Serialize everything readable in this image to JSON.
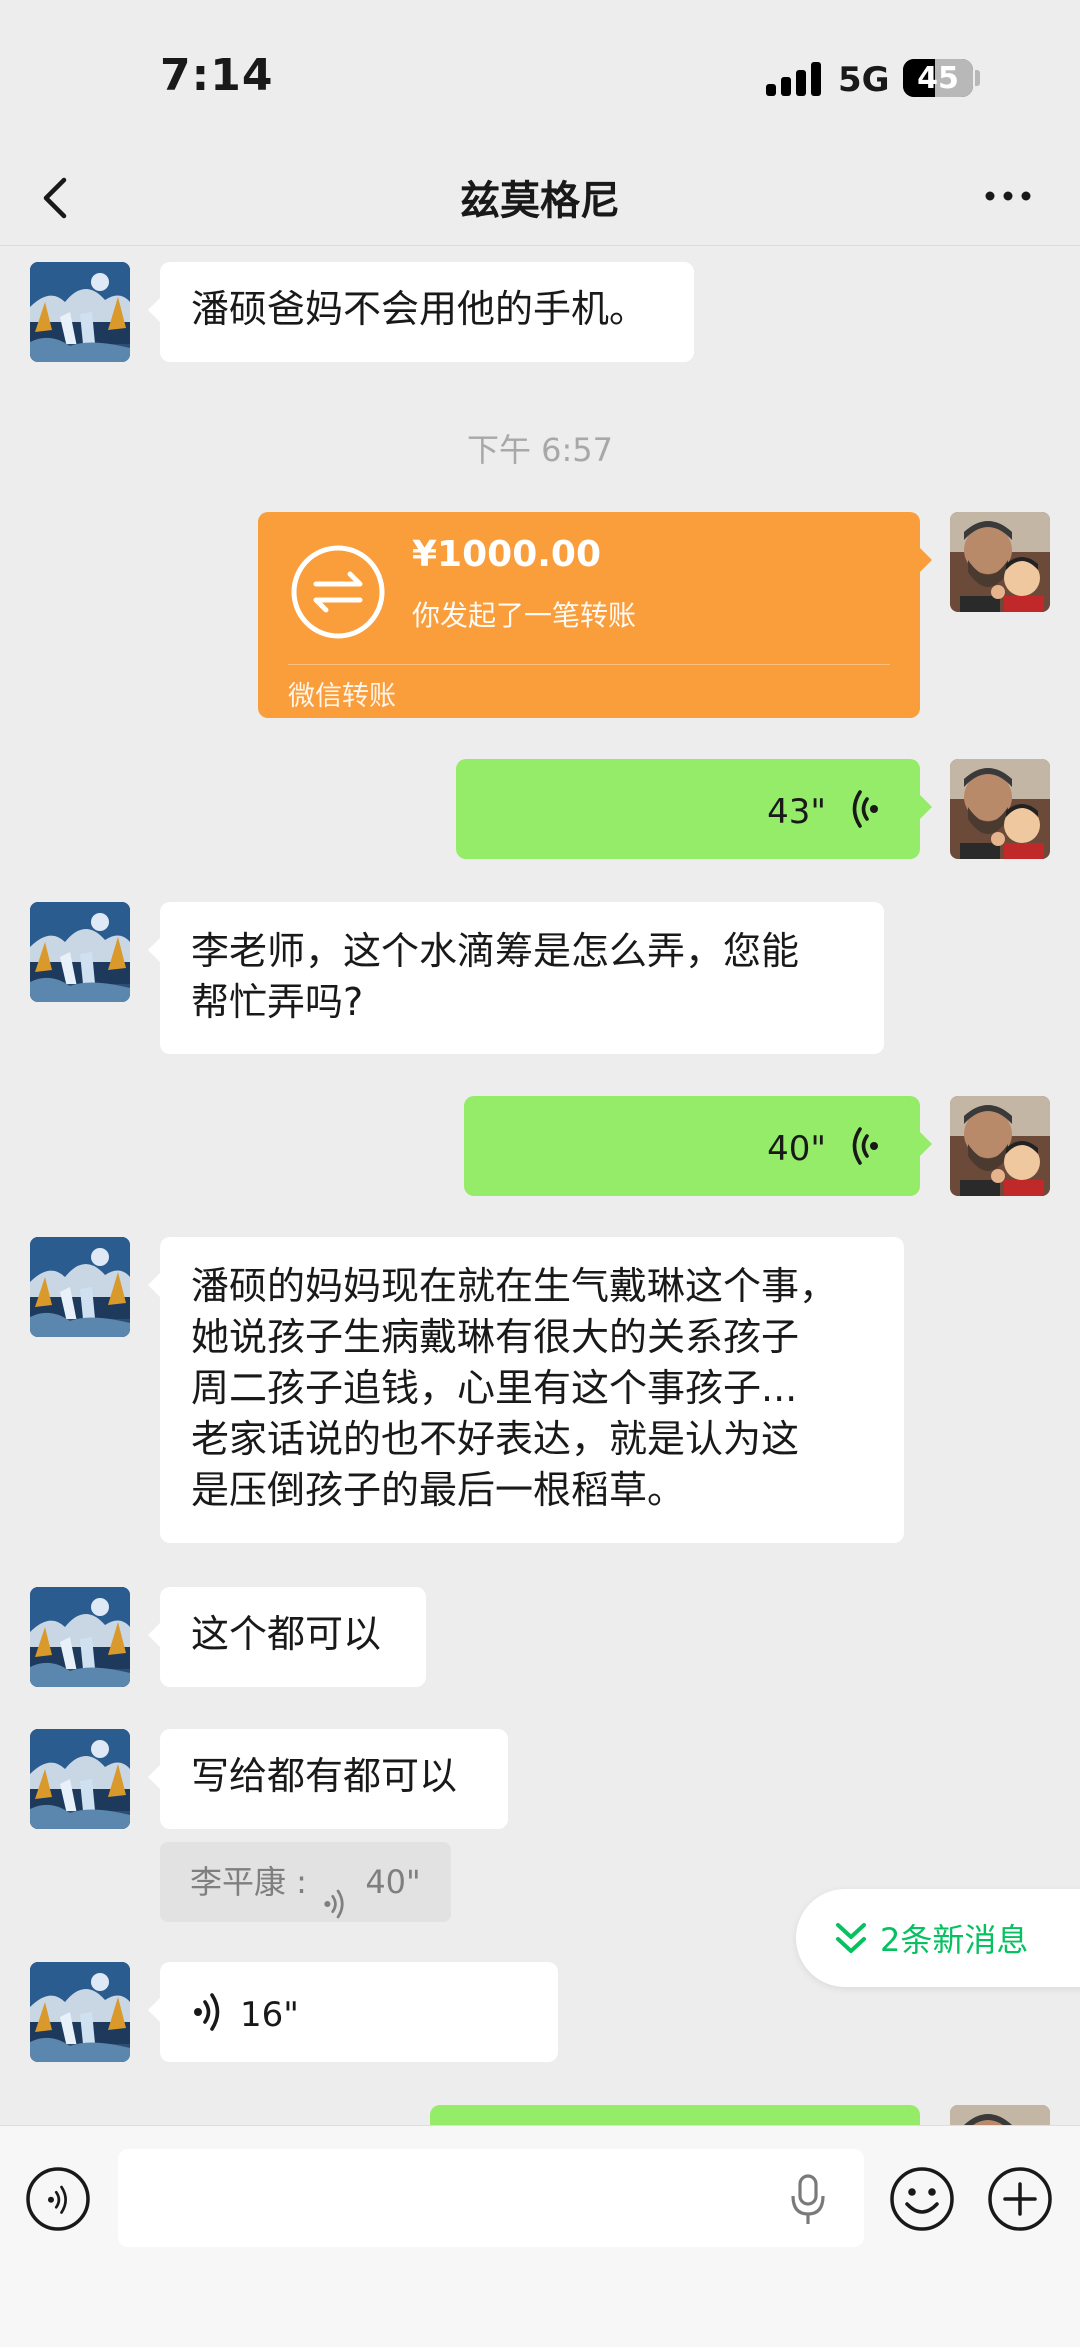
{
  "status_bar": {
    "time": "7:14",
    "network": "5G",
    "battery": "45",
    "battery_level": 0.45
  },
  "nav": {
    "title": "兹莫格尼"
  },
  "messages": {
    "m1": "潘硕爸妈不会用他的手机。",
    "timestamp": "下午 6:57",
    "transfer": {
      "amount": "¥1000.00",
      "desc": "你发起了一笔转账",
      "brand": "微信转账"
    },
    "voice_out_1": "43\"",
    "m2_line1": "李老师，这个水滴筹是怎么弄，您能",
    "m2_line2": "帮忙弄吗?",
    "voice_out_2": "40\"",
    "m3_line1": "潘硕的妈妈现在就在生气戴琳这个事，",
    "m3_line2": "她说孩子生病戴琳有很大的关系孩子",
    "m3_line3": "周二孩子追钱，心里有这个事孩子...",
    "m3_line4": "老家话说的也不好表达，就是认为这",
    "m3_line5": "是压倒孩子的最后一根稻草。",
    "m4": "这个都可以",
    "m5": "写给都有都可以",
    "quote_name": "李平康 :",
    "quote_len": "40\"",
    "voice_in": "16\""
  },
  "new_messages": {
    "label": "2条新消息"
  },
  "colors": {
    "accent_green": "#95ec69",
    "transfer_orange": "#fa9d3b",
    "wechat_green": "#07c160"
  },
  "icons": [
    "back-icon",
    "more-icon",
    "transfer-icon",
    "voice-wave-icon",
    "chevron-double-down-icon",
    "voice-mode-icon",
    "mic-icon",
    "emoji-icon",
    "plus-icon"
  ]
}
